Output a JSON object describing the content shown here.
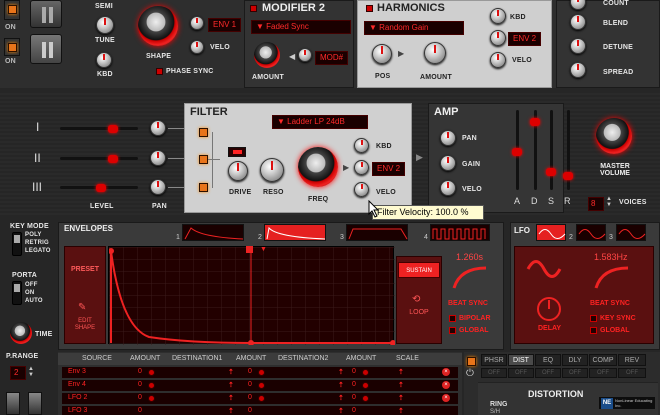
{
  "osc": {
    "on_label": "ON",
    "semi": "SEMI",
    "tune": "TUNE",
    "kbd": "KBD",
    "shape": "SHAPE",
    "phase_sync": "PHASE SYNC",
    "env_value": "ENV 1",
    "velo": "VELO"
  },
  "modifier2": {
    "title": "MODIFIER 2",
    "mode": "Faded Sync",
    "amount": "AMOUNT",
    "mod_display": "MOD#"
  },
  "harmonics": {
    "title": "HARMONICS",
    "mode": "Random Gain",
    "kbd": "KBD",
    "env": "ENV 2",
    "velo": "VELO",
    "pos": "POS",
    "amount": "AMOUNT"
  },
  "right_col": {
    "count": "COUNT",
    "blend": "BLEND",
    "detune": "DETUNE",
    "spread": "SPREAD"
  },
  "mixer": {
    "roman": [
      "I",
      "II",
      "III"
    ],
    "level": "LEVEL",
    "pan": "PAN"
  },
  "filter": {
    "title": "FILTER",
    "type": "Ladder LP 24dB",
    "drive": "DRIVE",
    "reso": "RESO",
    "freq": "FREQ",
    "kbd": "KBD",
    "env": "ENV 2",
    "velo": "VELO"
  },
  "amp": {
    "title": "AMP",
    "pan": "PAN",
    "gain": "GAIN",
    "velo": "VELO",
    "adsr": [
      "A",
      "D",
      "S",
      "R"
    ]
  },
  "master": {
    "label": "MASTER VOLUME",
    "voices_value": "8",
    "voices_label": "VOICES"
  },
  "tooltip": "Filter Velocity: 100.0 %",
  "keymode": {
    "label": "KEY MODE",
    "options": [
      "POLY",
      "RETRIG",
      "LEGATO"
    ]
  },
  "porta": {
    "label": "PORTA",
    "options": [
      "OFF",
      "ON",
      "AUTO"
    ],
    "time": "TIME"
  },
  "prange": {
    "label": "P.RANGE",
    "value": "2"
  },
  "envelopes": {
    "title": "ENVELOPES",
    "tabs": [
      "1",
      "2",
      "3",
      "4"
    ],
    "preset": "PRESET",
    "edit_shape": "EDIT SHAPE",
    "sustain": "SUSTAIN",
    "loop": "LOOP",
    "time": "1.260s",
    "beat_sync": "BEAT SYNC",
    "bipolar": "BIPOLAR",
    "global": "GLOBAL"
  },
  "lfo": {
    "title": "LFO",
    "tabs": [
      "1",
      "2",
      "3"
    ],
    "rate": "1.583Hz",
    "delay": "DELAY",
    "beat_sync": "BEAT SYNC",
    "key_sync": "KEY SYNC",
    "global": "GLOBAL"
  },
  "matrix": {
    "headers": [
      "SOURCE",
      "AMOUNT",
      "DESTINATION1",
      "AMOUNT",
      "DESTINATION2",
      "AMOUNT",
      "SCALE"
    ],
    "rows": [
      {
        "source": "Env 3",
        "a1": "0",
        "a2": "0",
        "a3": "0"
      },
      {
        "source": "Env 4",
        "a1": "0",
        "a2": "0",
        "a3": "0"
      },
      {
        "source": "LFO 2",
        "a1": "0",
        "a2": "0",
        "a3": "0"
      },
      {
        "source": "LFO 3",
        "a1": "0",
        "a2": "0",
        "a3": "0"
      }
    ]
  },
  "fx": {
    "tabs": [
      "PHSR",
      "DIST",
      "EQ",
      "DLY",
      "COMP",
      "REV"
    ],
    "offs": [
      "OFF",
      "OFF",
      "OFF",
      "OFF",
      "OFF",
      "OFF"
    ],
    "distortion": "DISTORTION",
    "ring": "RING",
    "ring_sub": "S/H",
    "logo": "NonLinear Educating Inc."
  },
  "colors": {
    "accent": "#e01010",
    "orange": "#e8741a",
    "panel": "#3a3a3a",
    "bg": "#262626"
  }
}
